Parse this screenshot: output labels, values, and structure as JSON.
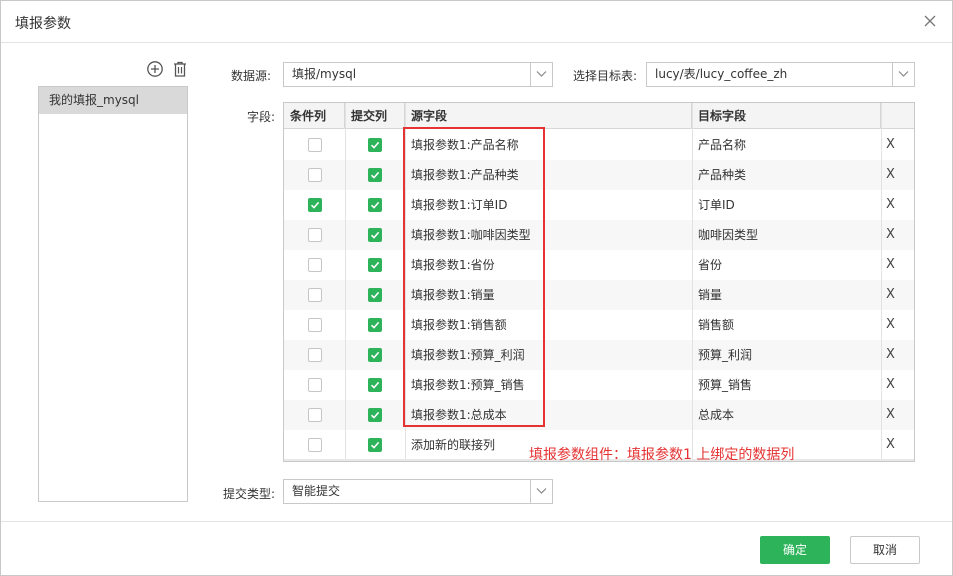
{
  "dialog": {
    "title": "填报参数"
  },
  "left_panel": {
    "items": [
      {
        "label": "我的填报_mysql",
        "selected": true
      }
    ]
  },
  "form": {
    "datasource_label": "数据源:",
    "datasource_value": "填报/mysql",
    "target_table_label": "选择目标表:",
    "target_table_value": "lucy/表/lucy_coffee_zh",
    "fields_label": "字段:",
    "submit_type_label": "提交类型:",
    "submit_type_value": "智能提交"
  },
  "table": {
    "headers": {
      "condition": "条件列",
      "submit": "提交列",
      "source": "源字段",
      "target": "目标字段"
    },
    "rows": [
      {
        "condition": false,
        "submit": true,
        "source": "填报参数1:产品名称",
        "target": "产品名称",
        "delete": "X"
      },
      {
        "condition": false,
        "submit": true,
        "source": "填报参数1:产品种类",
        "target": "产品种类",
        "delete": "X"
      },
      {
        "condition": true,
        "submit": true,
        "source": "填报参数1:订单ID",
        "target": "订单ID",
        "delete": "X"
      },
      {
        "condition": false,
        "submit": true,
        "source": "填报参数1:咖啡因类型",
        "target": "咖啡因类型",
        "delete": "X"
      },
      {
        "condition": false,
        "submit": true,
        "source": "填报参数1:省份",
        "target": "省份",
        "delete": "X"
      },
      {
        "condition": false,
        "submit": true,
        "source": "填报参数1:销量",
        "target": "销量",
        "delete": "X"
      },
      {
        "condition": false,
        "submit": true,
        "source": "填报参数1:销售额",
        "target": "销售额",
        "delete": "X"
      },
      {
        "condition": false,
        "submit": true,
        "source": "填报参数1:预算_利润",
        "target": "预算_利润",
        "delete": "X"
      },
      {
        "condition": false,
        "submit": true,
        "source": "填报参数1:预算_销售",
        "target": "预算_销售",
        "delete": "X"
      },
      {
        "condition": false,
        "submit": true,
        "source": "填报参数1:总成本",
        "target": "总成本",
        "delete": "X"
      },
      {
        "condition": false,
        "submit": true,
        "source": "添加新的联接列",
        "target": "",
        "delete": "X"
      }
    ]
  },
  "annotation": {
    "text": "填报参数组件：填报参数1 上绑定的数据列",
    "color": "#e53333"
  },
  "footer": {
    "ok_label": "确定",
    "cancel_label": "取消"
  },
  "colors": {
    "accent": "#2db35a",
    "highlight": "#e53333"
  },
  "icons": [
    "close-icon",
    "add-circle-icon",
    "trash-icon",
    "chevron-down-icon",
    "checkmark-icon"
  ]
}
